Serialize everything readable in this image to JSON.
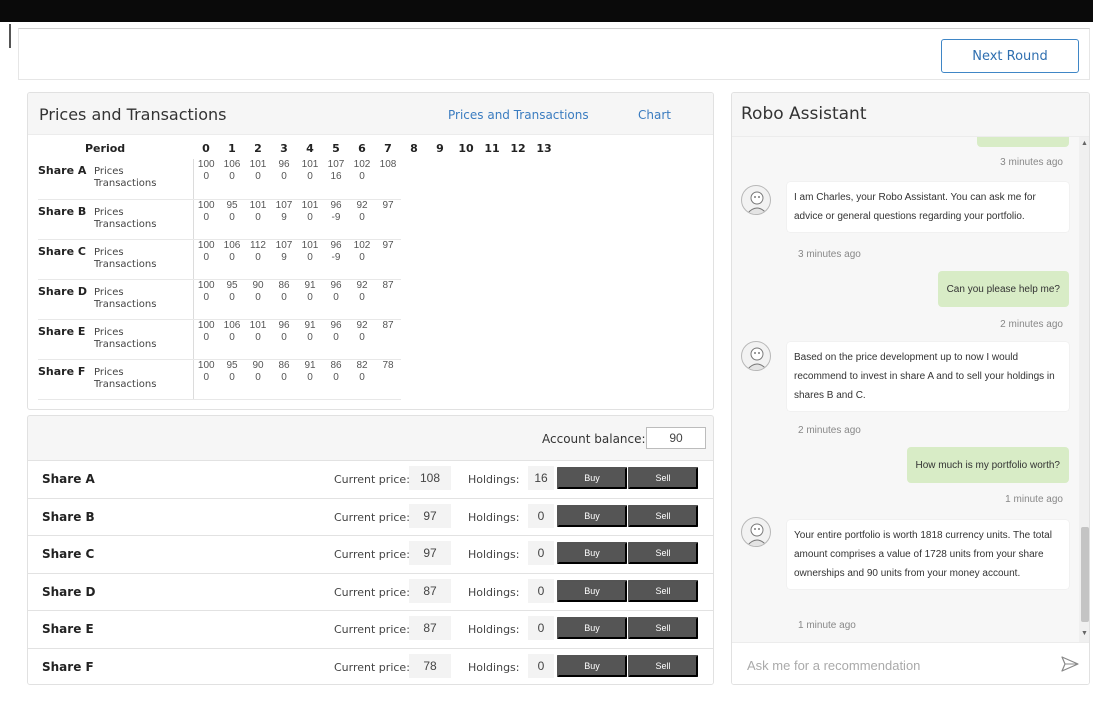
{
  "header": {
    "next_round_label": "Next Round"
  },
  "prices": {
    "title": "Prices and Transactions",
    "tabs": [
      "Prices and Transactions",
      "Chart"
    ],
    "period_label": "Period",
    "periods": [
      "0",
      "1",
      "2",
      "3",
      "4",
      "5",
      "6",
      "7",
      "8",
      "9",
      "10",
      "11",
      "12",
      "13"
    ],
    "row_labels": {
      "prices": "Prices",
      "transactions": "Transactions"
    },
    "shares": [
      {
        "name": "Share A",
        "prices": [
          "100",
          "106",
          "101",
          "96",
          "101",
          "107",
          "102",
          "108"
        ],
        "transactions": [
          "0",
          "0",
          "0",
          "0",
          "0",
          "16",
          "0"
        ]
      },
      {
        "name": "Share B",
        "prices": [
          "100",
          "95",
          "101",
          "107",
          "101",
          "96",
          "92",
          "97"
        ],
        "transactions": [
          "0",
          "0",
          "0",
          "9",
          "0",
          "-9",
          "0"
        ]
      },
      {
        "name": "Share C",
        "prices": [
          "100",
          "106",
          "112",
          "107",
          "101",
          "96",
          "102",
          "97"
        ],
        "transactions": [
          "0",
          "0",
          "0",
          "9",
          "0",
          "-9",
          "0"
        ]
      },
      {
        "name": "Share D",
        "prices": [
          "100",
          "95",
          "90",
          "86",
          "91",
          "96",
          "92",
          "87"
        ],
        "transactions": [
          "0",
          "0",
          "0",
          "0",
          "0",
          "0",
          "0"
        ]
      },
      {
        "name": "Share E",
        "prices": [
          "100",
          "106",
          "101",
          "96",
          "91",
          "96",
          "92",
          "87"
        ],
        "transactions": [
          "0",
          "0",
          "0",
          "0",
          "0",
          "0",
          "0"
        ]
      },
      {
        "name": "Share F",
        "prices": [
          "100",
          "95",
          "90",
          "86",
          "91",
          "86",
          "82",
          "78"
        ],
        "transactions": [
          "0",
          "0",
          "0",
          "0",
          "0",
          "0",
          "0"
        ]
      }
    ]
  },
  "trade": {
    "account_balance_label": "Account balance:",
    "account_balance": "90",
    "current_price_label": "Current price:",
    "holdings_label": "Holdings:",
    "buy_label": "Buy",
    "sell_label": "Sell",
    "rows": [
      {
        "name": "Share A",
        "price": "108",
        "holdings": "16"
      },
      {
        "name": "Share B",
        "price": "97",
        "holdings": "0"
      },
      {
        "name": "Share C",
        "price": "97",
        "holdings": "0"
      },
      {
        "name": "Share D",
        "price": "87",
        "holdings": "0"
      },
      {
        "name": "Share E",
        "price": "87",
        "holdings": "0"
      },
      {
        "name": "Share F",
        "price": "78",
        "holdings": "0"
      }
    ]
  },
  "robo": {
    "title": "Robo Assistant",
    "messages": {
      "t0": "3 minutes ago",
      "bot1": "I am Charles, your Robo Assistant. You can ask me for advice  or general questions regarding your portfolio.",
      "bot1_time": "3 minutes ago",
      "user1": "Can you please help me?",
      "user1_time": "2 minutes ago",
      "bot2": "Based on the price development up to now I would recommend to invest in share A and to sell your holdings in shares B and C.",
      "bot2_time": "2 minutes ago",
      "user2": "How much is my portfolio worth?",
      "user2_time": "1 minute ago",
      "bot3": "Your entire portfolio is worth 1818 currency units. The total amount comprises a value of 1728 units from your share ownerships and 90 units from your money account.",
      "bot3_time": "1 minute ago"
    },
    "input_placeholder": "Ask me for a recommendation",
    "colors": {
      "user_bubble": "#d8ecc6",
      "bot_bubble": "#ffffff",
      "link": "#3a7cc0",
      "button": "#555555"
    }
  }
}
